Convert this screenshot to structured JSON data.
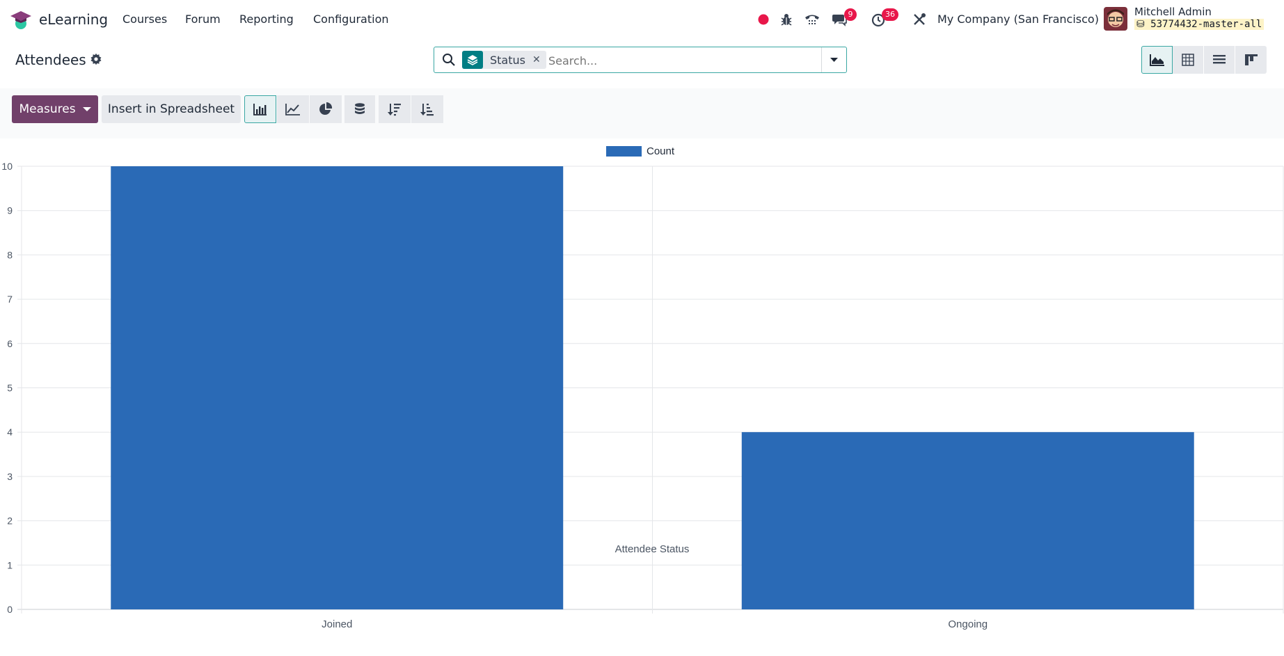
{
  "navbar": {
    "app_name": "eLearning",
    "menus": [
      "Courses",
      "Forum",
      "Reporting",
      "Configuration"
    ],
    "messages_count": "9",
    "activities_count": "36",
    "company": "My Company (San Francisco)",
    "user_name": "Mitchell Admin",
    "database": "53774432-master-all"
  },
  "control_panel": {
    "title": "Attendees",
    "facet_label": "Status",
    "search_placeholder": "Search..."
  },
  "toolbar": {
    "measures_label": "Measures",
    "spreadsheet_label": "Insert in Spreadsheet"
  },
  "colors": {
    "brand": "#71406a",
    "accent": "#017e84",
    "bar": "#2a6ab6",
    "badge": "#e8174a"
  },
  "chart_data": {
    "type": "bar",
    "categories": [
      "Joined",
      "Ongoing"
    ],
    "series": [
      {
        "name": "Count",
        "values": [
          10,
          4
        ]
      }
    ],
    "xlabel": "Attendee Status",
    "ylabel": "",
    "ylim": [
      0,
      10
    ],
    "yticks": [
      0,
      1,
      2,
      3,
      4,
      5,
      6,
      7,
      8,
      9,
      10
    ],
    "grid": true,
    "legend": "top-center"
  }
}
